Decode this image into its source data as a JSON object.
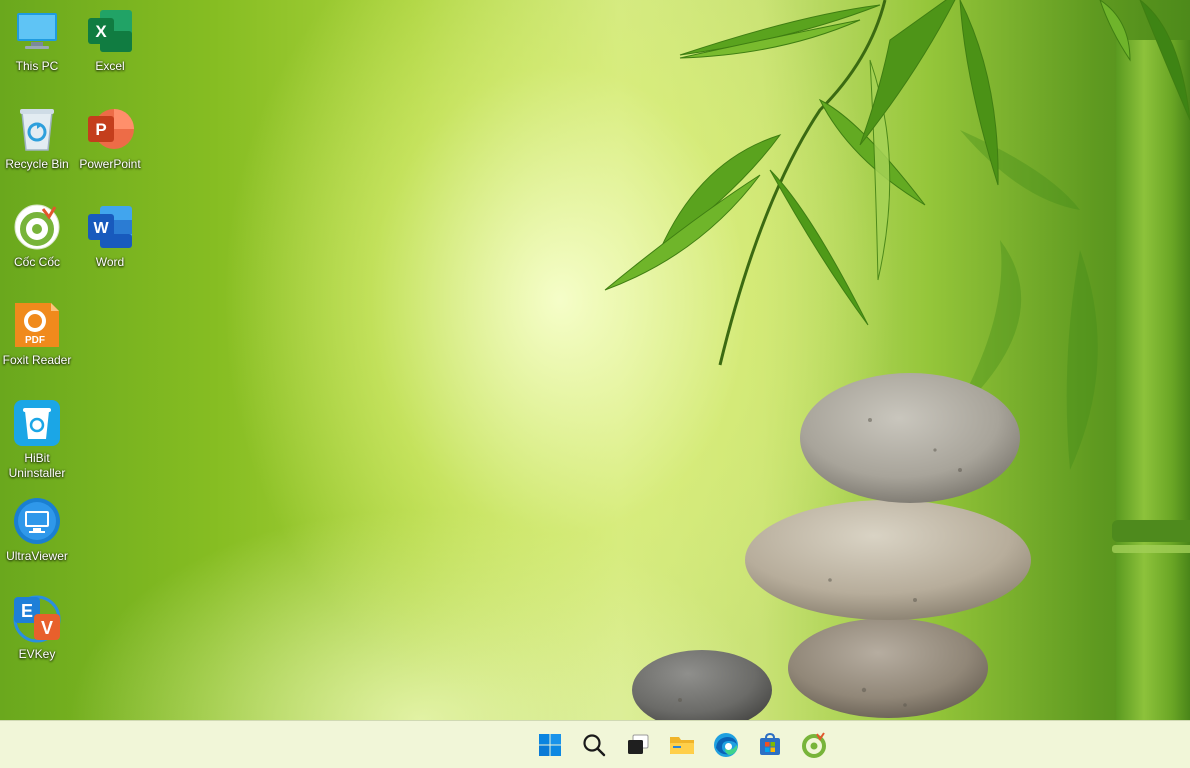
{
  "desktop": {
    "icons": [
      {
        "label": "This PC",
        "icon": "this-pc-icon"
      },
      {
        "label": "Excel",
        "icon": "excel-icon"
      },
      {
        "label": "Recycle Bin",
        "icon": "recycle-bin-icon"
      },
      {
        "label": "PowerPoint",
        "icon": "powerpoint-icon"
      },
      {
        "label": "Cốc Cốc",
        "icon": "coccoc-icon"
      },
      {
        "label": "Word",
        "icon": "word-icon"
      },
      {
        "label": "Foxit Reader",
        "icon": "foxit-reader-icon"
      },
      {
        "label": "HiBit\nUninstaller",
        "icon": "hibit-uninstaller-icon"
      },
      {
        "label": "UltraViewer",
        "icon": "ultraviewer-icon"
      },
      {
        "label": "EVKey",
        "icon": "evkey-icon"
      }
    ],
    "glyphs": {
      "excel": "X",
      "powerpoint": "P",
      "word": "W",
      "foxit": "PDF",
      "evkey_e": "E",
      "evkey_v": "V"
    }
  },
  "taskbar": {
    "items": [
      {
        "name": "start",
        "icon": "windows-start-icon"
      },
      {
        "name": "search",
        "icon": "search-icon"
      },
      {
        "name": "task-view",
        "icon": "task-view-icon"
      },
      {
        "name": "file-explorer",
        "icon": "folder-icon"
      },
      {
        "name": "edge",
        "icon": "edge-icon"
      },
      {
        "name": "store",
        "icon": "store-icon"
      },
      {
        "name": "coccoc",
        "icon": "coccoc-icon"
      }
    ]
  },
  "colors": {
    "excel": "#107c41",
    "powerpoint": "#c43e1c",
    "word": "#185abd",
    "foxit": "#f08a1c",
    "windows_blue": "#0078d4"
  }
}
